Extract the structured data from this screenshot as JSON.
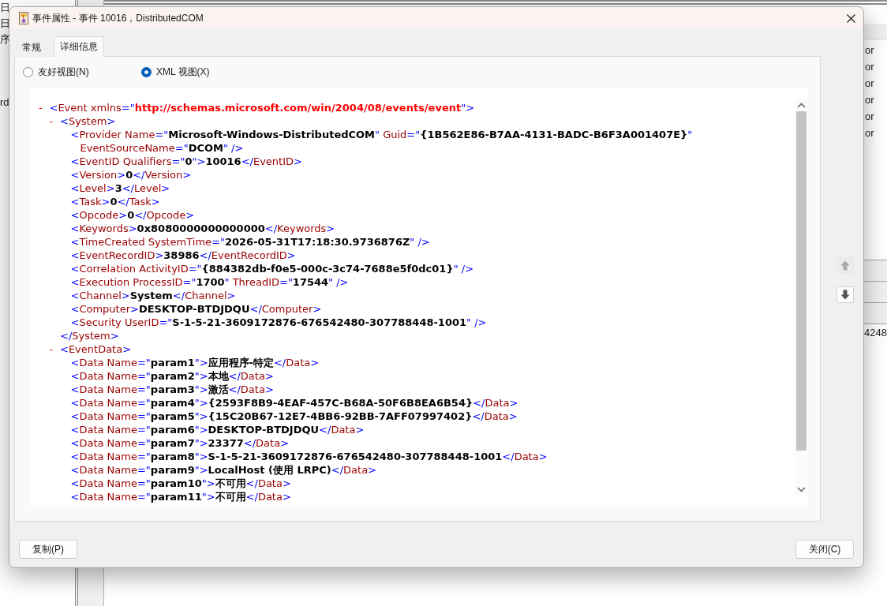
{
  "background_window": {
    "left_column": [
      "日",
      "日",
      "序"
    ],
    "left_column_lower": [
      "rd"
    ],
    "right_column": [
      "or",
      "or",
      "or",
      "or",
      "or",
      "or"
    ],
    "lower_cell": "4248"
  },
  "dialog": {
    "title": "事件属性 - 事件 10016，DistributedCOM",
    "tabs": [
      {
        "label": "常规",
        "selected": false
      },
      {
        "label": "详细信息",
        "selected": true
      }
    ],
    "view_options": [
      {
        "label": "友好视图(N)",
        "selected": false
      },
      {
        "label": "XML 视图(X)",
        "selected": true
      }
    ],
    "xml_view": {
      "nodes": [
        {
          "toggle": "-",
          "tokens": [
            {
              "kind": "markup",
              "text": "<"
            },
            {
              "kind": "name",
              "text": "Event"
            },
            {
              "kind": "name",
              "text": " xmlns"
            },
            {
              "kind": "markup",
              "text": "=\""
            },
            {
              "kind": "namespace",
              "text": "http://schemas.microsoft.com/win/2004/08/events/event"
            },
            {
              "kind": "markup",
              "text": "\">"
            }
          ],
          "children": [
            {
              "toggle": "-",
              "tokens": [
                {
                  "kind": "markup",
                  "text": "<"
                },
                {
                  "kind": "name",
                  "text": "System"
                },
                {
                  "kind": "markup",
                  "text": ">"
                }
              ],
              "children": [
                {
                  "tokens": [
                    {
                      "kind": "markup",
                      "text": "<"
                    },
                    {
                      "kind": "name",
                      "text": "Provider"
                    },
                    {
                      "kind": "name",
                      "text": " Name"
                    },
                    {
                      "kind": "markup",
                      "text": "=\""
                    },
                    {
                      "kind": "value",
                      "text": "Microsoft-Windows-DistributedCOM"
                    },
                    {
                      "kind": "markup",
                      "text": "\""
                    },
                    {
                      "kind": "name",
                      "text": " Guid"
                    },
                    {
                      "kind": "markup",
                      "text": "=\""
                    },
                    {
                      "kind": "value",
                      "text": "{1B562E86-B7AA-4131-BADC-B6F3A001407E}"
                    },
                    {
                      "kind": "markup",
                      "text": "\""
                    }
                  ],
                  "continuation": [
                    {
                      "kind": "name",
                      "text": "EventSourceName"
                    },
                    {
                      "kind": "markup",
                      "text": "=\""
                    },
                    {
                      "kind": "value",
                      "text": "DCOM"
                    },
                    {
                      "kind": "markup",
                      "text": "\" />"
                    }
                  ]
                },
                {
                  "tokens": [
                    {
                      "kind": "markup",
                      "text": "<"
                    },
                    {
                      "kind": "name",
                      "text": "EventID"
                    },
                    {
                      "kind": "name",
                      "text": " Qualifiers"
                    },
                    {
                      "kind": "markup",
                      "text": "=\""
                    },
                    {
                      "kind": "value",
                      "text": "0"
                    },
                    {
                      "kind": "markup",
                      "text": "\">"
                    },
                    {
                      "kind": "value",
                      "text": "10016"
                    },
                    {
                      "kind": "markup",
                      "text": "</"
                    },
                    {
                      "kind": "name",
                      "text": "EventID"
                    },
                    {
                      "kind": "markup",
                      "text": ">"
                    }
                  ]
                },
                {
                  "tokens": [
                    {
                      "kind": "markup",
                      "text": "<"
                    },
                    {
                      "kind": "name",
                      "text": "Version"
                    },
                    {
                      "kind": "markup",
                      "text": ">"
                    },
                    {
                      "kind": "value",
                      "text": "0"
                    },
                    {
                      "kind": "markup",
                      "text": "</"
                    },
                    {
                      "kind": "name",
                      "text": "Version"
                    },
                    {
                      "kind": "markup",
                      "text": ">"
                    }
                  ]
                },
                {
                  "tokens": [
                    {
                      "kind": "markup",
                      "text": "<"
                    },
                    {
                      "kind": "name",
                      "text": "Level"
                    },
                    {
                      "kind": "markup",
                      "text": ">"
                    },
                    {
                      "kind": "value",
                      "text": "3"
                    },
                    {
                      "kind": "markup",
                      "text": "</"
                    },
                    {
                      "kind": "name",
                      "text": "Level"
                    },
                    {
                      "kind": "markup",
                      "text": ">"
                    }
                  ]
                },
                {
                  "tokens": [
                    {
                      "kind": "markup",
                      "text": "<"
                    },
                    {
                      "kind": "name",
                      "text": "Task"
                    },
                    {
                      "kind": "markup",
                      "text": ">"
                    },
                    {
                      "kind": "value",
                      "text": "0"
                    },
                    {
                      "kind": "markup",
                      "text": "</"
                    },
                    {
                      "kind": "name",
                      "text": "Task"
                    },
                    {
                      "kind": "markup",
                      "text": ">"
                    }
                  ]
                },
                {
                  "tokens": [
                    {
                      "kind": "markup",
                      "text": "<"
                    },
                    {
                      "kind": "name",
                      "text": "Opcode"
                    },
                    {
                      "kind": "markup",
                      "text": ">"
                    },
                    {
                      "kind": "value",
                      "text": "0"
                    },
                    {
                      "kind": "markup",
                      "text": "</"
                    },
                    {
                      "kind": "name",
                      "text": "Opcode"
                    },
                    {
                      "kind": "markup",
                      "text": ">"
                    }
                  ]
                },
                {
                  "tokens": [
                    {
                      "kind": "markup",
                      "text": "<"
                    },
                    {
                      "kind": "name",
                      "text": "Keywords"
                    },
                    {
                      "kind": "markup",
                      "text": ">"
                    },
                    {
                      "kind": "value",
                      "text": "0x8080000000000000"
                    },
                    {
                      "kind": "markup",
                      "text": "</"
                    },
                    {
                      "kind": "name",
                      "text": "Keywords"
                    },
                    {
                      "kind": "markup",
                      "text": ">"
                    }
                  ]
                },
                {
                  "tokens": [
                    {
                      "kind": "markup",
                      "text": "<"
                    },
                    {
                      "kind": "name",
                      "text": "TimeCreated"
                    },
                    {
                      "kind": "name",
                      "text": " SystemTime"
                    },
                    {
                      "kind": "markup",
                      "text": "=\""
                    },
                    {
                      "kind": "value",
                      "text": "2026-05-31T17:18:30.9736876Z"
                    },
                    {
                      "kind": "markup",
                      "text": "\" />"
                    }
                  ]
                },
                {
                  "tokens": [
                    {
                      "kind": "markup",
                      "text": "<"
                    },
                    {
                      "kind": "name",
                      "text": "EventRecordID"
                    },
                    {
                      "kind": "markup",
                      "text": ">"
                    },
                    {
                      "kind": "value",
                      "text": "38986"
                    },
                    {
                      "kind": "markup",
                      "text": "</"
                    },
                    {
                      "kind": "name",
                      "text": "EventRecordID"
                    },
                    {
                      "kind": "markup",
                      "text": ">"
                    }
                  ]
                },
                {
                  "tokens": [
                    {
                      "kind": "markup",
                      "text": "<"
                    },
                    {
                      "kind": "name",
                      "text": "Correlation"
                    },
                    {
                      "kind": "name",
                      "text": " ActivityID"
                    },
                    {
                      "kind": "markup",
                      "text": "=\""
                    },
                    {
                      "kind": "value",
                      "text": "{884382db-f0e5-000c-3c74-7688e5f0dc01}"
                    },
                    {
                      "kind": "markup",
                      "text": "\" />"
                    }
                  ]
                },
                {
                  "tokens": [
                    {
                      "kind": "markup",
                      "text": "<"
                    },
                    {
                      "kind": "name",
                      "text": "Execution"
                    },
                    {
                      "kind": "name",
                      "text": " ProcessID"
                    },
                    {
                      "kind": "markup",
                      "text": "=\""
                    },
                    {
                      "kind": "value",
                      "text": "1700"
                    },
                    {
                      "kind": "markup",
                      "text": "\""
                    },
                    {
                      "kind": "name",
                      "text": " ThreadID"
                    },
                    {
                      "kind": "markup",
                      "text": "=\""
                    },
                    {
                      "kind": "value",
                      "text": "17544"
                    },
                    {
                      "kind": "markup",
                      "text": "\" />"
                    }
                  ]
                },
                {
                  "tokens": [
                    {
                      "kind": "markup",
                      "text": "<"
                    },
                    {
                      "kind": "name",
                      "text": "Channel"
                    },
                    {
                      "kind": "markup",
                      "text": ">"
                    },
                    {
                      "kind": "value",
                      "text": "System"
                    },
                    {
                      "kind": "markup",
                      "text": "</"
                    },
                    {
                      "kind": "name",
                      "text": "Channel"
                    },
                    {
                      "kind": "markup",
                      "text": ">"
                    }
                  ]
                },
                {
                  "tokens": [
                    {
                      "kind": "markup",
                      "text": "<"
                    },
                    {
                      "kind": "name",
                      "text": "Computer"
                    },
                    {
                      "kind": "markup",
                      "text": ">"
                    },
                    {
                      "kind": "value",
                      "text": "DESKTOP-BTDJDQU"
                    },
                    {
                      "kind": "markup",
                      "text": "</"
                    },
                    {
                      "kind": "name",
                      "text": "Computer"
                    },
                    {
                      "kind": "markup",
                      "text": ">"
                    }
                  ]
                },
                {
                  "tokens": [
                    {
                      "kind": "markup",
                      "text": "<"
                    },
                    {
                      "kind": "name",
                      "text": "Security"
                    },
                    {
                      "kind": "name",
                      "text": " UserID"
                    },
                    {
                      "kind": "markup",
                      "text": "=\""
                    },
                    {
                      "kind": "value",
                      "text": "S-1-5-21-3609172876-676542480-307788448-1001"
                    },
                    {
                      "kind": "markup",
                      "text": "\" />"
                    }
                  ]
                }
              ],
              "closing": [
                {
                  "kind": "markup",
                  "text": "</"
                },
                {
                  "kind": "name",
                  "text": "System"
                },
                {
                  "kind": "markup",
                  "text": ">"
                }
              ]
            },
            {
              "toggle": "-",
              "tokens": [
                {
                  "kind": "markup",
                  "text": "<"
                },
                {
                  "kind": "name",
                  "text": "EventData"
                },
                {
                  "kind": "markup",
                  "text": ">"
                }
              ],
              "children": [
                {
                  "tokens": [
                    {
                      "kind": "markup",
                      "text": "<"
                    },
                    {
                      "kind": "name",
                      "text": "Data"
                    },
                    {
                      "kind": "name",
                      "text": " Name"
                    },
                    {
                      "kind": "markup",
                      "text": "=\""
                    },
                    {
                      "kind": "value",
                      "text": "param1"
                    },
                    {
                      "kind": "markup",
                      "text": "\">"
                    },
                    {
                      "kind": "value",
                      "text": "应用程序-特定"
                    },
                    {
                      "kind": "markup",
                      "text": "</"
                    },
                    {
                      "kind": "name",
                      "text": "Data"
                    },
                    {
                      "kind": "markup",
                      "text": ">"
                    }
                  ]
                },
                {
                  "tokens": [
                    {
                      "kind": "markup",
                      "text": "<"
                    },
                    {
                      "kind": "name",
                      "text": "Data"
                    },
                    {
                      "kind": "name",
                      "text": " Name"
                    },
                    {
                      "kind": "markup",
                      "text": "=\""
                    },
                    {
                      "kind": "value",
                      "text": "param2"
                    },
                    {
                      "kind": "markup",
                      "text": "\">"
                    },
                    {
                      "kind": "value",
                      "text": "本地"
                    },
                    {
                      "kind": "markup",
                      "text": "</"
                    },
                    {
                      "kind": "name",
                      "text": "Data"
                    },
                    {
                      "kind": "markup",
                      "text": ">"
                    }
                  ]
                },
                {
                  "tokens": [
                    {
                      "kind": "markup",
                      "text": "<"
                    },
                    {
                      "kind": "name",
                      "text": "Data"
                    },
                    {
                      "kind": "name",
                      "text": " Name"
                    },
                    {
                      "kind": "markup",
                      "text": "=\""
                    },
                    {
                      "kind": "value",
                      "text": "param3"
                    },
                    {
                      "kind": "markup",
                      "text": "\">"
                    },
                    {
                      "kind": "value",
                      "text": "激活"
                    },
                    {
                      "kind": "markup",
                      "text": "</"
                    },
                    {
                      "kind": "name",
                      "text": "Data"
                    },
                    {
                      "kind": "markup",
                      "text": ">"
                    }
                  ]
                },
                {
                  "tokens": [
                    {
                      "kind": "markup",
                      "text": "<"
                    },
                    {
                      "kind": "name",
                      "text": "Data"
                    },
                    {
                      "kind": "name",
                      "text": " Name"
                    },
                    {
                      "kind": "markup",
                      "text": "=\""
                    },
                    {
                      "kind": "value",
                      "text": "param4"
                    },
                    {
                      "kind": "markup",
                      "text": "\">"
                    },
                    {
                      "kind": "value",
                      "text": "{2593F8B9-4EAF-457C-B68A-50F6B8EA6B54}"
                    },
                    {
                      "kind": "markup",
                      "text": "</"
                    },
                    {
                      "kind": "name",
                      "text": "Data"
                    },
                    {
                      "kind": "markup",
                      "text": ">"
                    }
                  ]
                },
                {
                  "tokens": [
                    {
                      "kind": "markup",
                      "text": "<"
                    },
                    {
                      "kind": "name",
                      "text": "Data"
                    },
                    {
                      "kind": "name",
                      "text": " Name"
                    },
                    {
                      "kind": "markup",
                      "text": "=\""
                    },
                    {
                      "kind": "value",
                      "text": "param5"
                    },
                    {
                      "kind": "markup",
                      "text": "\">"
                    },
                    {
                      "kind": "value",
                      "text": "{15C20B67-12E7-4BB6-92BB-7AFF07997402}"
                    },
                    {
                      "kind": "markup",
                      "text": "</"
                    },
                    {
                      "kind": "name",
                      "text": "Data"
                    },
                    {
                      "kind": "markup",
                      "text": ">"
                    }
                  ]
                },
                {
                  "tokens": [
                    {
                      "kind": "markup",
                      "text": "<"
                    },
                    {
                      "kind": "name",
                      "text": "Data"
                    },
                    {
                      "kind": "name",
                      "text": " Name"
                    },
                    {
                      "kind": "markup",
                      "text": "=\""
                    },
                    {
                      "kind": "value",
                      "text": "param6"
                    },
                    {
                      "kind": "markup",
                      "text": "\">"
                    },
                    {
                      "kind": "value",
                      "text": "DESKTOP-BTDJDQU"
                    },
                    {
                      "kind": "markup",
                      "text": "</"
                    },
                    {
                      "kind": "name",
                      "text": "Data"
                    },
                    {
                      "kind": "markup",
                      "text": ">"
                    }
                  ]
                },
                {
                  "tokens": [
                    {
                      "kind": "markup",
                      "text": "<"
                    },
                    {
                      "kind": "name",
                      "text": "Data"
                    },
                    {
                      "kind": "name",
                      "text": " Name"
                    },
                    {
                      "kind": "markup",
                      "text": "=\""
                    },
                    {
                      "kind": "value",
                      "text": "param7"
                    },
                    {
                      "kind": "markup",
                      "text": "\">"
                    },
                    {
                      "kind": "value",
                      "text": "23377"
                    },
                    {
                      "kind": "markup",
                      "text": "</"
                    },
                    {
                      "kind": "name",
                      "text": "Data"
                    },
                    {
                      "kind": "markup",
                      "text": ">"
                    }
                  ]
                },
                {
                  "tokens": [
                    {
                      "kind": "markup",
                      "text": "<"
                    },
                    {
                      "kind": "name",
                      "text": "Data"
                    },
                    {
                      "kind": "name",
                      "text": " Name"
                    },
                    {
                      "kind": "markup",
                      "text": "=\""
                    },
                    {
                      "kind": "value",
                      "text": "param8"
                    },
                    {
                      "kind": "markup",
                      "text": "\">"
                    },
                    {
                      "kind": "value",
                      "text": "S-1-5-21-3609172876-676542480-307788448-1001"
                    },
                    {
                      "kind": "markup",
                      "text": "</"
                    },
                    {
                      "kind": "name",
                      "text": "Data"
                    },
                    {
                      "kind": "markup",
                      "text": ">"
                    }
                  ]
                },
                {
                  "tokens": [
                    {
                      "kind": "markup",
                      "text": "<"
                    },
                    {
                      "kind": "name",
                      "text": "Data"
                    },
                    {
                      "kind": "name",
                      "text": " Name"
                    },
                    {
                      "kind": "markup",
                      "text": "=\""
                    },
                    {
                      "kind": "value",
                      "text": "param9"
                    },
                    {
                      "kind": "markup",
                      "text": "\">"
                    },
                    {
                      "kind": "value",
                      "text": "LocalHost (使用 LRPC)"
                    },
                    {
                      "kind": "markup",
                      "text": "</"
                    },
                    {
                      "kind": "name",
                      "text": "Data"
                    },
                    {
                      "kind": "markup",
                      "text": ">"
                    }
                  ]
                },
                {
                  "tokens": [
                    {
                      "kind": "markup",
                      "text": "<"
                    },
                    {
                      "kind": "name",
                      "text": "Data"
                    },
                    {
                      "kind": "name",
                      "text": " Name"
                    },
                    {
                      "kind": "markup",
                      "text": "=\""
                    },
                    {
                      "kind": "value",
                      "text": "param10"
                    },
                    {
                      "kind": "markup",
                      "text": "\">"
                    },
                    {
                      "kind": "value",
                      "text": "不可用"
                    },
                    {
                      "kind": "markup",
                      "text": "</"
                    },
                    {
                      "kind": "name",
                      "text": "Data"
                    },
                    {
                      "kind": "markup",
                      "text": ">"
                    }
                  ]
                },
                {
                  "tokens": [
                    {
                      "kind": "markup",
                      "text": "<"
                    },
                    {
                      "kind": "name",
                      "text": "Data"
                    },
                    {
                      "kind": "name",
                      "text": " Name"
                    },
                    {
                      "kind": "markup",
                      "text": "=\""
                    },
                    {
                      "kind": "value",
                      "text": "param11"
                    },
                    {
                      "kind": "markup",
                      "text": "\">"
                    },
                    {
                      "kind": "value",
                      "text": "不可用"
                    },
                    {
                      "kind": "markup",
                      "text": "</"
                    },
                    {
                      "kind": "name",
                      "text": "Data"
                    },
                    {
                      "kind": "markup",
                      "text": ">"
                    }
                  ]
                }
              ]
            }
          ]
        }
      ]
    },
    "nav_buttons": [
      {
        "kind": "up",
        "disabled": true
      },
      {
        "kind": "down",
        "disabled": false
      }
    ],
    "buttons": [
      "复制(P)",
      "关闭(C)"
    ]
  }
}
